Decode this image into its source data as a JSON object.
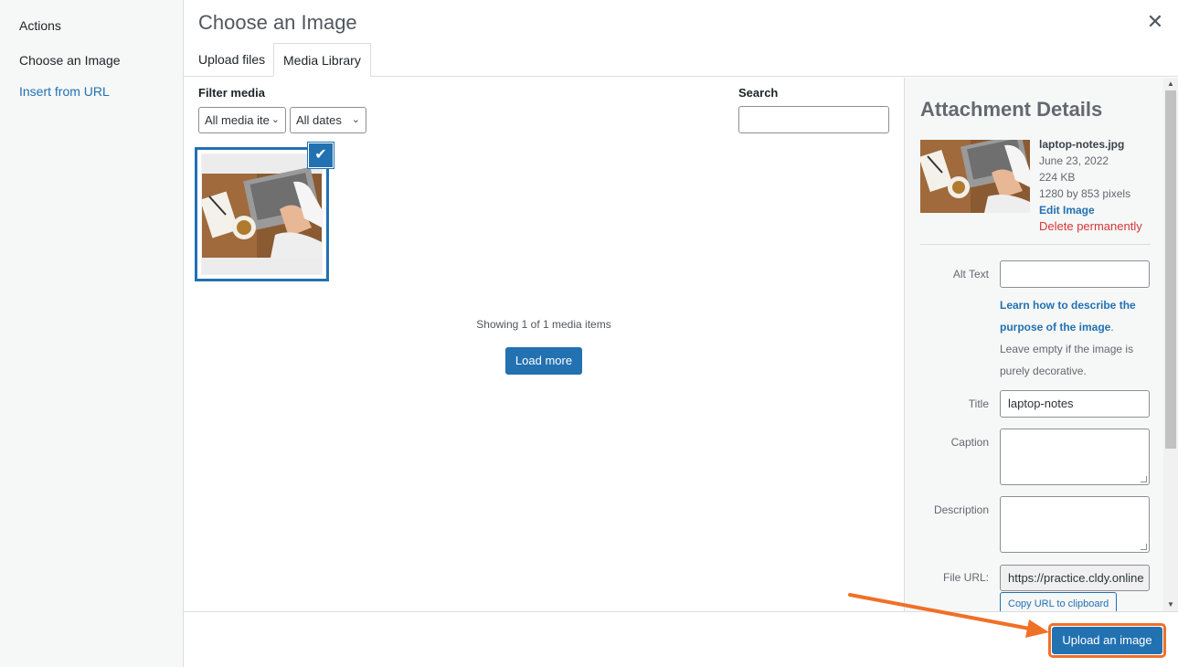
{
  "left_menu": {
    "heading": "Actions",
    "items": [
      "Choose an Image",
      "Insert from URL"
    ]
  },
  "frame": {
    "title": "Choose an Image",
    "close_icon": "close-icon"
  },
  "tabs": [
    "Upload files",
    "Media Library"
  ],
  "filters": {
    "label": "Filter media",
    "type_value": "All media ite",
    "date_value": "All dates",
    "search_label": "Search",
    "search_value": ""
  },
  "media": {
    "showing_text": "Showing 1 of 1 media items",
    "load_more_label": "Load more"
  },
  "attachment_details": {
    "title": "Attachment Details",
    "filename": "laptop-notes.jpg",
    "date": "June 23, 2022",
    "size": "224 KB",
    "dimensions": "1280 by 853 pixels",
    "edit_label": "Edit Image",
    "delete_label": "Delete permanently",
    "alt_text_label": "Alt Text",
    "alt_text_value": "",
    "help_link": "Learn how to describe the purpose of the image",
    "help_suffix": ". Leave empty if the image is purely decorative.",
    "title_label": "Title",
    "title_value": "laptop-notes",
    "caption_label": "Caption",
    "description_label": "Description",
    "file_url_label": "File URL:",
    "file_url_value": "https://practice.cldy.online",
    "copy_url_label": "Copy URL to clipboard"
  },
  "toolbar": {
    "upload_label": "Upload an image"
  },
  "colors": {
    "accent": "#2271b1",
    "delete": "#d63638",
    "highlight": "#f07027"
  }
}
